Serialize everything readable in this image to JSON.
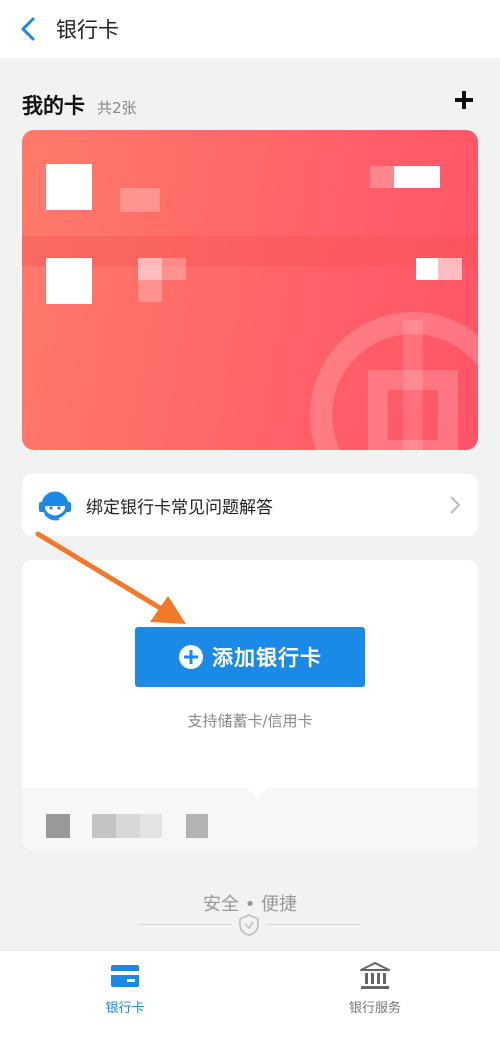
{
  "nav": {
    "title": "银行卡"
  },
  "cards": {
    "title": "我的卡",
    "count": "共2张"
  },
  "faq": {
    "label": "绑定银行卡常见问题解答"
  },
  "add_panel": {
    "button_label": "添加银行卡",
    "support_text": "支持储蓄卡/信用卡"
  },
  "footer": {
    "slogan": "安全 • 便捷"
  },
  "tabs": [
    {
      "label": "银行卡",
      "icon": "bank-card-icon",
      "active": true
    },
    {
      "label": "银行服务",
      "icon": "bank-building-icon",
      "active": false
    }
  ],
  "colors": {
    "accent": "#1b8ae6",
    "card_gradient_start": "#ff7a6a",
    "card_gradient_end": "#ff5466",
    "annotation_arrow": "#f07a2a"
  }
}
